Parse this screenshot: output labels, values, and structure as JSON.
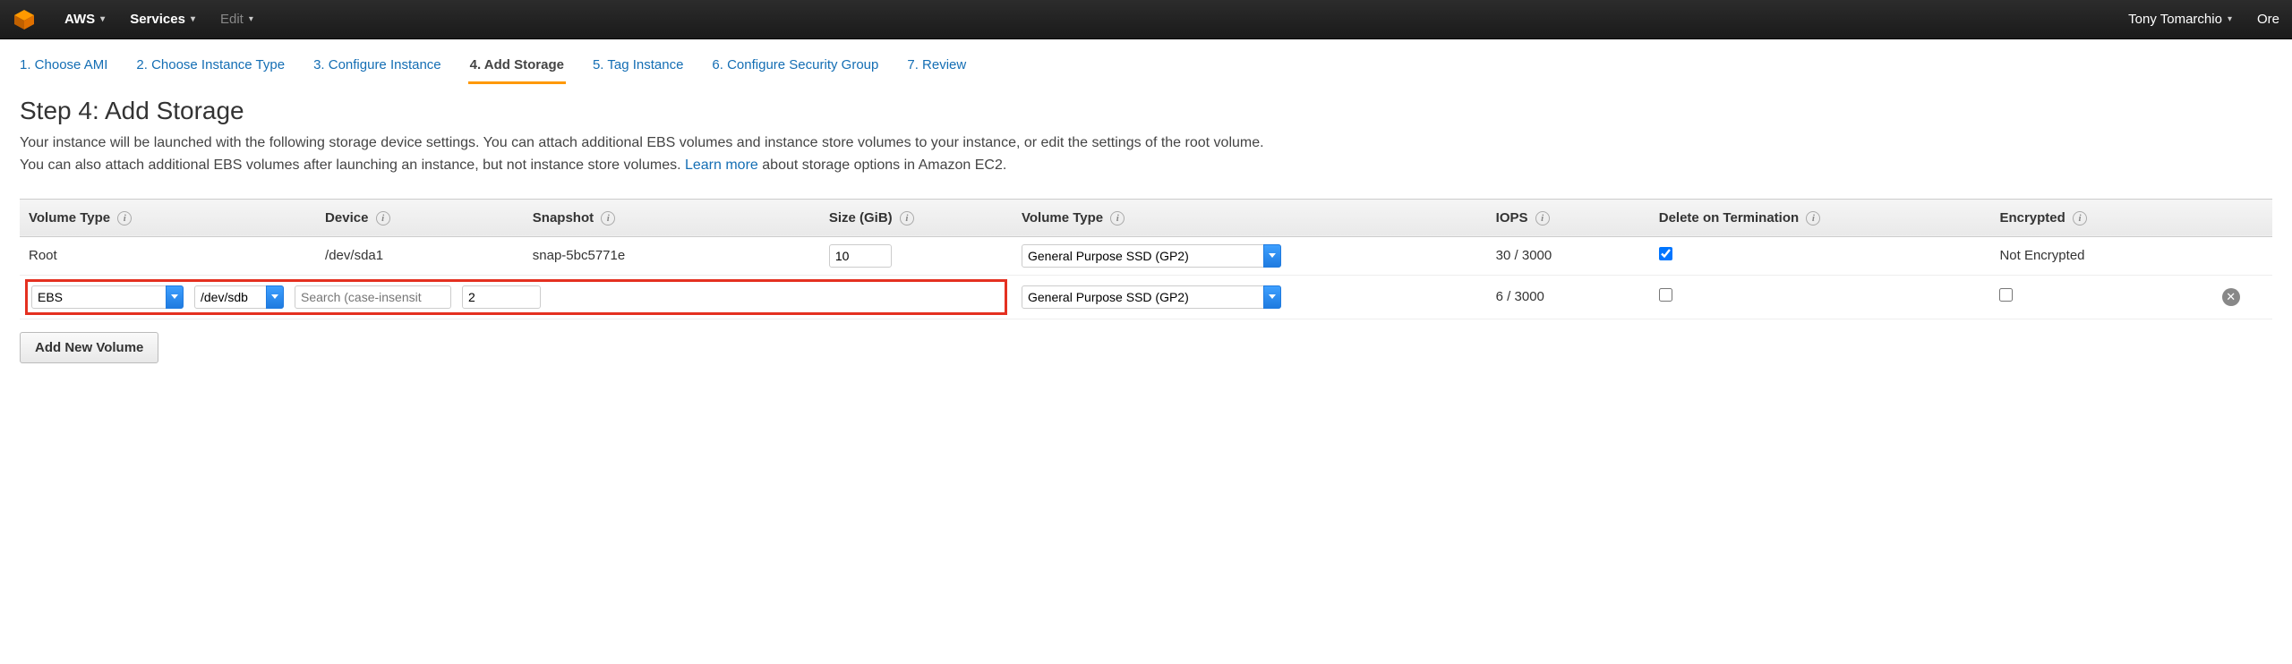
{
  "nav": {
    "aws": "AWS",
    "services": "Services",
    "edit": "Edit",
    "user": "Tony Tomarchio",
    "region_fragment": "Ore"
  },
  "wizard_tabs": [
    "1. Choose AMI",
    "2. Choose Instance Type",
    "3. Configure Instance",
    "4. Add Storage",
    "5. Tag Instance",
    "6. Configure Security Group",
    "7. Review"
  ],
  "wizard_active_index": 3,
  "step": {
    "title": "Step 4: Add Storage",
    "desc_1": "Your instance will be launched with the following storage device settings. You can attach additional EBS volumes and instance store volumes to your instance, or edit the settings of the root volume. You can also attach additional EBS volumes after launching an instance, but not instance store volumes. ",
    "learn_more": "Learn more",
    "desc_2": " about storage options in Amazon EC2."
  },
  "table": {
    "headers": {
      "volume_type_category": "Volume Type",
      "device": "Device",
      "snapshot": "Snapshot",
      "size": "Size (GiB)",
      "volume_type": "Volume Type",
      "iops": "IOPS",
      "delete_on_termination": "Delete on Termination",
      "encrypted": "Encrypted"
    },
    "row_root": {
      "volume_type_category": "Root",
      "device": "/dev/sda1",
      "snapshot": "snap-5bc5771e",
      "size": "10",
      "volume_type_selected": "General Purpose SSD (GP2)",
      "iops": "30 / 3000",
      "delete_on_termination": true,
      "encrypted": "Not Encrypted"
    },
    "row_ebs": {
      "volume_type_category_selected": "EBS",
      "device_selected": "/dev/sdb",
      "snapshot_placeholder": "Search (case-insensit",
      "size": "2",
      "volume_type_selected": "General Purpose SSD (GP2)",
      "iops": "6 / 3000",
      "delete_on_termination": false,
      "encrypted": false
    }
  },
  "add_button": "Add New Volume"
}
